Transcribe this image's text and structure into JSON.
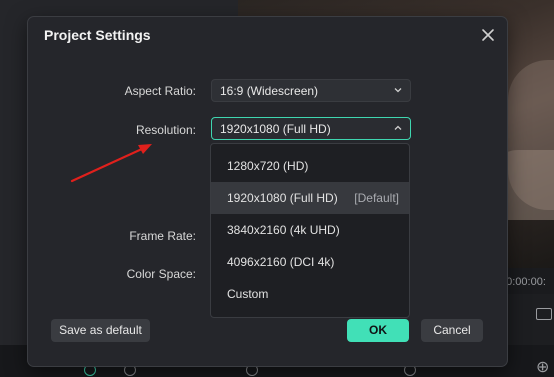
{
  "background": {
    "timecode": "00:00:00:"
  },
  "dialog": {
    "title": "Project Settings",
    "fields": {
      "aspect_ratio": {
        "label": "Aspect Ratio:",
        "value": "16:9 (Widescreen)"
      },
      "resolution": {
        "label": "Resolution:",
        "value": "1920x1080 (Full HD)"
      },
      "frame_rate": {
        "label": "Frame Rate:"
      },
      "color_space": {
        "label": "Color Space:"
      }
    },
    "resolution_options": [
      {
        "label": "1280x720 (HD)",
        "tag": ""
      },
      {
        "label": "1920x1080 (Full HD)",
        "tag": "[Default]"
      },
      {
        "label": "3840x2160 (4k UHD)",
        "tag": ""
      },
      {
        "label": "4096x2160 (DCI 4k)",
        "tag": ""
      },
      {
        "label": "Custom",
        "tag": ""
      }
    ],
    "buttons": {
      "save_default": "Save as default",
      "ok": "OK",
      "cancel": "Cancel"
    }
  },
  "colors": {
    "accent": "#41e0b7",
    "annotation_arrow": "#e0201c"
  },
  "icons": {
    "close": "close-icon",
    "chevron_down": "chevron-down-icon",
    "chevron_up": "chevron-up-icon"
  }
}
